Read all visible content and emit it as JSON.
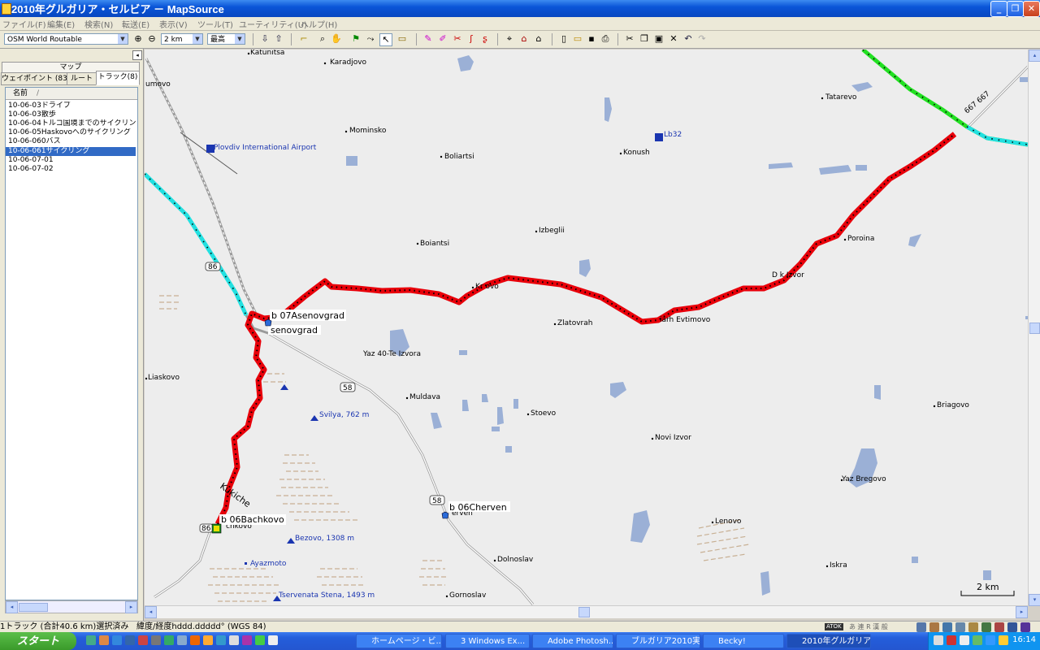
{
  "window": {
    "title": "2010年グルガリア・セルビア － MapSource",
    "min": "_",
    "max": "❐",
    "close": "✕"
  },
  "menu": [
    "ファイル(F)",
    "編集(E)",
    "検索(N)",
    "転送(E)",
    "表示(V)",
    "ツール(T)",
    "ユーティリティ(U)",
    "ヘルプ(H)"
  ],
  "toolbar": {
    "map_product": "OSM World Routable",
    "zoom_scale": "2 km",
    "detail": "最高"
  },
  "panel": {
    "map_tab": "マップ",
    "tabs": [
      "ウェイポイント (83)",
      "ルート",
      "トラック(8)"
    ],
    "list_header": "名前",
    "sort_indicator": "/",
    "tracks": [
      "10-06-03ドライブ",
      "10-06-03散歩",
      "10-06-04トルコ国境までのサイクリング",
      "10-06-05Haskovoへのサイクリング",
      "10-06-060バス",
      "10-06-061サイクリング",
      "10-06-07-01",
      "10-06-07-02"
    ],
    "selected_index": 5
  },
  "map": {
    "towns": [
      {
        "name": "Katunitsa"
      },
      {
        "name": "Karadjovo"
      },
      {
        "name": "umovo"
      },
      {
        "name": "Mominsko"
      },
      {
        "name": "Boliartsi"
      },
      {
        "name": "Konush"
      },
      {
        "name": "Tatarevo"
      },
      {
        "name": "Izbeglii"
      },
      {
        "name": "Boiantsi"
      },
      {
        "name": "Poroina"
      },
      {
        "name": "Zlatovrah"
      },
      {
        "name": "Liaskovo"
      },
      {
        "name": "Muldava"
      },
      {
        "name": "Stoevo"
      },
      {
        "name": "Novi Izvor"
      },
      {
        "name": "Briagovo"
      },
      {
        "name": "Yaz Bregovo"
      },
      {
        "name": "Lenovo"
      },
      {
        "name": "Dolnoslav"
      },
      {
        "name": "Iskra"
      },
      {
        "name": "Gornoslav"
      },
      {
        "name": "Yaz 40-Te Izvora"
      },
      {
        "name": "chkovo"
      },
      {
        "name": "erven"
      },
      {
        "name": "Kr  ovo"
      },
      {
        "name": "D  k Izvor"
      },
      {
        "name": "  iarh Evtimovo"
      }
    ],
    "pois": [
      {
        "name": "Plovdiv International Airport"
      },
      {
        "name": "Lb32"
      },
      {
        "name": "Svilya, 762 m"
      },
      {
        "name": "Bezovo, 1308 m"
      },
      {
        "name": "Ayazmoto"
      },
      {
        "name": "Tservenata Stena, 1493 m"
      }
    ],
    "waypoints": [
      {
        "name": "b 07Asenovgrad"
      },
      {
        "name": "b 06Cherven"
      },
      {
        "name": "b 06Bachkovo"
      }
    ],
    "labels": {
      "asenovgrad": "senovgrad",
      "kukiche": "Kukiche",
      "road_667": "667  667",
      "road_86": "86",
      "road_86b": "86",
      "road_58a": "58",
      "road_58b": "58"
    },
    "scale": "2 km",
    "colors": {
      "track": "#e8000a",
      "road_green": "#22e022",
      "road_cyan": "#22e0e0",
      "water": "#9bb0d6"
    }
  },
  "status": {
    "selection": "1トラック (合計40.6 km)選択済み",
    "position_format": "緯度/経度hddd.ddddd°  (WGS 84)",
    "ime": "ATOK",
    "ime_flags": "あ 連 R 漢 般"
  },
  "taskbar": {
    "start": "スタート",
    "tasks": [
      "ホームページ・ビ...",
      "3 Windows Ex...",
      "Adobe Photosh...",
      "ブルガリア2010実...",
      "Becky!",
      "2010年グルガリア..."
    ],
    "clock": "16:14"
  }
}
